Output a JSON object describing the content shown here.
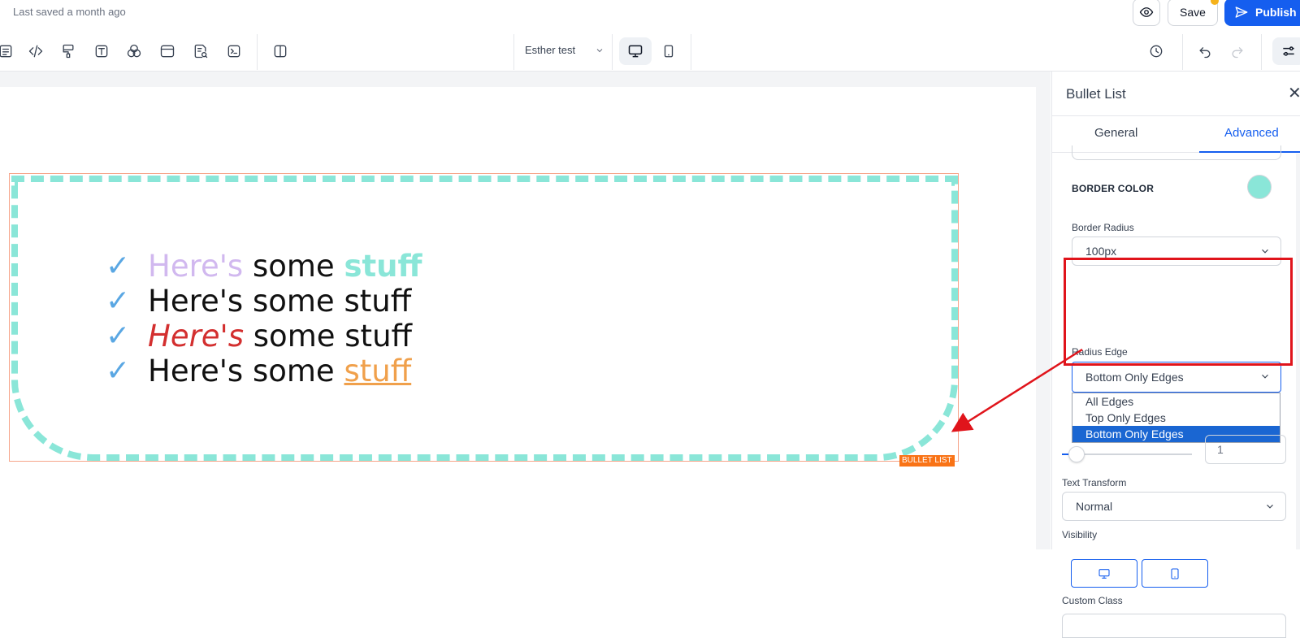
{
  "header": {
    "saved_status": "Last saved a month ago",
    "save_label": "Save",
    "publish_label": "Publish",
    "font_select_value": "Esther test"
  },
  "canvas": {
    "bullet_items": [
      {
        "w1": "Here's",
        "w2": "some",
        "w3": "stuff"
      },
      {
        "w1": "Here's",
        "w2": "some",
        "w3": "stuff"
      },
      {
        "w1": "Here's",
        "w2": "some",
        "w3": "stuff"
      },
      {
        "w1": "Here's",
        "w2": "some",
        "w3": "stuff"
      }
    ],
    "element_tag": "BULLET LIST",
    "colors": {
      "border": "#8ae6d8",
      "lavender": "#d1b8ef",
      "red": "#d32f2f",
      "orange": "#f0a04b",
      "check": "#5aa7e3"
    }
  },
  "panel": {
    "title": "Bullet List",
    "tabs": {
      "general": "General",
      "advanced": "Advanced"
    },
    "border_color_label": "BORDER COLOR",
    "border_color_value": "#8ae6d8",
    "border_radius_label": "Border Radius",
    "border_radius_value": "100px",
    "radius_edge_label": "Radius Edge",
    "radius_edge_value": "Bottom Only Edges",
    "radius_edge_options": [
      "All Edges",
      "Top Only Edges",
      "Bottom Only Edges"
    ],
    "slider_value": "1",
    "text_transform_label": "Text Transform",
    "text_transform_value": "Normal",
    "visibility_label": "Visibility",
    "custom_class_label": "Custom Class"
  }
}
